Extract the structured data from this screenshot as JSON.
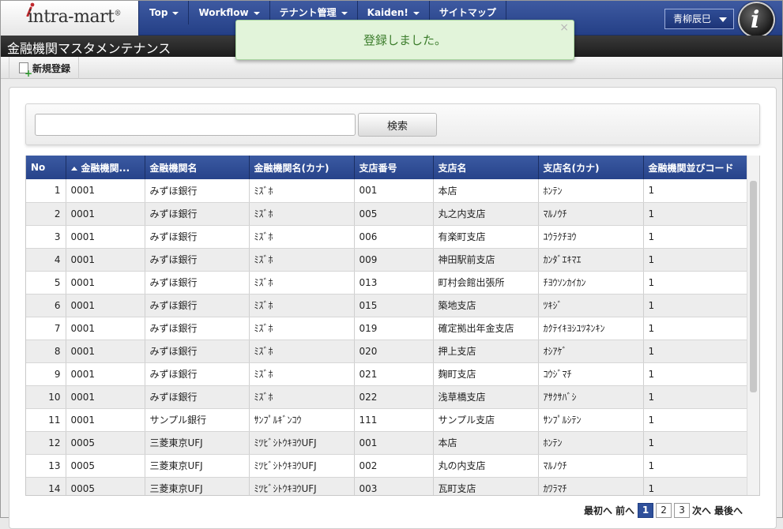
{
  "header": {
    "logo_text": "intra-mart",
    "logo_mark": "®",
    "nav": [
      {
        "label": "Top",
        "has_caret": true
      },
      {
        "label": "Workflow",
        "has_caret": true
      },
      {
        "label": "テナント管理",
        "has_caret": true
      },
      {
        "label": "Kaiden!",
        "has_caret": true
      },
      {
        "label": "サイトマップ",
        "has_caret": false
      }
    ],
    "user_name": "青柳辰巳",
    "badge_letter": "i"
  },
  "page_title": "金融機関マスタメンテナンス",
  "toolbar": {
    "new_label": "新規登録"
  },
  "toast": {
    "message": "登録しました。",
    "close": "×"
  },
  "search": {
    "value": "",
    "placeholder": "",
    "button_label": "検索"
  },
  "table": {
    "columns": [
      "No",
      "金融機関...",
      "金融機関名",
      "金融機関名(カナ)",
      "支店番号",
      "支店名",
      "支店名(カナ)",
      "金融機関並びコード"
    ],
    "rows": [
      [
        "1",
        "0001",
        "みずほ銀行",
        "ﾐｽﾞﾎ",
        "001",
        "本店",
        "ﾎﾝﾃﾝ",
        "1"
      ],
      [
        "2",
        "0001",
        "みずほ銀行",
        "ﾐｽﾞﾎ",
        "005",
        "丸之内支店",
        "ﾏﾙﾉｳﾁ",
        "1"
      ],
      [
        "3",
        "0001",
        "みずほ銀行",
        "ﾐｽﾞﾎ",
        "006",
        "有楽町支店",
        "ﾕｳﾗｸﾁﾖｳ",
        "1"
      ],
      [
        "4",
        "0001",
        "みずほ銀行",
        "ﾐｽﾞﾎ",
        "009",
        "神田駅前支店",
        "ｶﾝﾀﾞｴｷﾏｴ",
        "1"
      ],
      [
        "5",
        "0001",
        "みずほ銀行",
        "ﾐｽﾞﾎ",
        "013",
        "町村会館出張所",
        "ﾁﾖｳｿﾝｶｲｶﾝ",
        "1"
      ],
      [
        "6",
        "0001",
        "みずほ銀行",
        "ﾐｽﾞﾎ",
        "015",
        "築地支店",
        "ﾂｷｼﾞ",
        "1"
      ],
      [
        "7",
        "0001",
        "みずほ銀行",
        "ﾐｽﾞﾎ",
        "019",
        "確定拠出年金支店",
        "ｶｸﾃｲｷﾖｼﾕﾂﾈﾝｷﾝ",
        "1"
      ],
      [
        "8",
        "0001",
        "みずほ銀行",
        "ﾐｽﾞﾎ",
        "020",
        "押上支店",
        "ｵｼｱｹﾞ",
        "1"
      ],
      [
        "9",
        "0001",
        "みずほ銀行",
        "ﾐｽﾞﾎ",
        "021",
        "麹町支店",
        "ｺｳｼﾞﾏﾁ",
        "1"
      ],
      [
        "10",
        "0001",
        "みずほ銀行",
        "ﾐｽﾞﾎ",
        "022",
        "浅草橋支店",
        "ｱｻｸｻﾊﾞｼ",
        "1"
      ],
      [
        "11",
        "0001",
        "サンプル銀行",
        "ｻﾝﾌﾟﾙｷﾞﾝｺｳ",
        "111",
        "サンプル支店",
        "ｻﾝﾌﾟﾙｼﾃﾝ",
        "1"
      ],
      [
        "12",
        "0005",
        "三菱東京UFJ",
        "ﾐﾂﾋﾞｼﾄｳｷﾖｳUFJ",
        "001",
        "本店",
        "ﾎﾝﾃﾝ",
        "1"
      ],
      [
        "13",
        "0005",
        "三菱東京UFJ",
        "ﾐﾂﾋﾞｼﾄｳｷﾖｳUFJ",
        "002",
        "丸の内支店",
        "ﾏﾙﾉｳﾁ",
        "1"
      ],
      [
        "14",
        "0005",
        "三菱東京UFJ",
        "ﾐﾂﾋﾞｼﾄｳｷﾖｳUFJ",
        "003",
        "瓦町支店",
        "ｶﾜﾗﾏﾁ",
        "1"
      ]
    ]
  },
  "pager": {
    "first": "最初へ",
    "prev": "前へ",
    "pages": [
      "1",
      "2",
      "3"
    ],
    "current": "1",
    "next": "次へ",
    "last": "最後へ"
  },
  "colors": {
    "nav_blue": "#2f4b94",
    "title_black": "#1c1c1c",
    "toast_green": "#e2f4da",
    "toast_text": "#3c7d2c"
  }
}
